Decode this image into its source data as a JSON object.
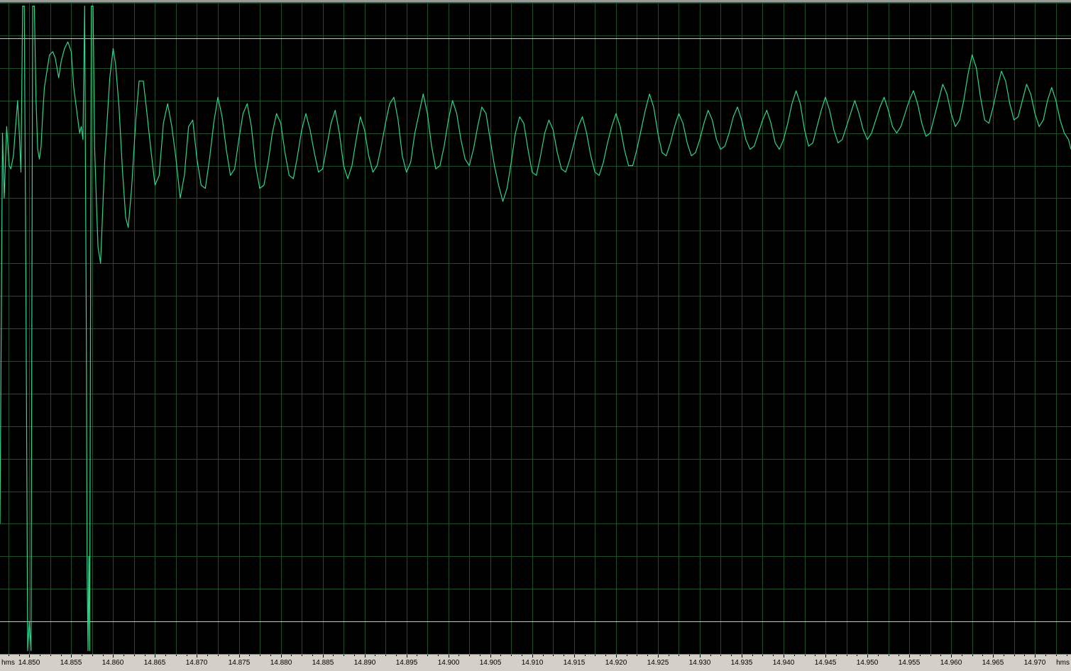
{
  "editor": {
    "time_unit_left": "hms",
    "time_unit_right": "hms"
  },
  "colors": {
    "background": "#000000",
    "grid": "#1d4d2a",
    "waveform": "#2fd58a",
    "center_line": "#a01818",
    "marker_line": "#c8c8c8",
    "ruler": "#d4d0c8"
  },
  "chart_data": {
    "type": "line",
    "xlabel": "hms",
    "ylabel": "",
    "xlim": [
      14.8465,
      14.9743
    ],
    "ylim": [
      -1,
      1
    ],
    "grid": true,
    "x_tick_labels": [
      "14.850",
      "14.855",
      "14.860",
      "14.865",
      "14.870",
      "14.875",
      "14.880",
      "14.885",
      "14.890",
      "14.895",
      "14.900",
      "14.905",
      "14.910",
      "14.915",
      "14.920",
      "14.925",
      "14.930",
      "14.935",
      "14.940",
      "14.945",
      "14.950",
      "14.955",
      "14.960",
      "14.965",
      "14.970"
    ],
    "reference_levels": [
      0.89,
      -0.9
    ],
    "series": [
      {
        "values": [
          [
            14.8465,
            -0.6
          ],
          [
            14.8468,
            0.6
          ],
          [
            14.847,
            0.4
          ],
          [
            14.8473,
            0.62
          ],
          [
            14.8476,
            0.5
          ],
          [
            14.8478,
            0.49
          ],
          [
            14.8481,
            0.53
          ],
          [
            14.8483,
            0.6
          ],
          [
            14.8486,
            0.7
          ],
          [
            14.8488,
            0.6
          ],
          [
            14.849,
            0.48
          ],
          [
            14.8492,
            0.99
          ],
          [
            14.8494,
            0.99
          ],
          [
            14.8496,
            0.1
          ],
          [
            14.8498,
            -0.99
          ],
          [
            14.85,
            -0.9
          ],
          [
            14.8502,
            -0.99
          ],
          [
            14.8504,
            0.99
          ],
          [
            14.8506,
            0.99
          ],
          [
            14.8508,
            0.7
          ],
          [
            14.851,
            0.55
          ],
          [
            14.8512,
            0.52
          ],
          [
            14.8514,
            0.56
          ],
          [
            14.8516,
            0.66
          ],
          [
            14.8518,
            0.74
          ],
          [
            14.8521,
            0.79
          ],
          [
            14.8524,
            0.84
          ],
          [
            14.8528,
            0.85
          ],
          [
            14.8531,
            0.83
          ],
          [
            14.8535,
            0.77
          ],
          [
            14.8538,
            0.82
          ],
          [
            14.8542,
            0.86
          ],
          [
            14.8546,
            0.88
          ],
          [
            14.855,
            0.85
          ],
          [
            14.8553,
            0.74
          ],
          [
            14.8557,
            0.66
          ],
          [
            14.856,
            0.6
          ],
          [
            14.8562,
            0.62
          ],
          [
            14.8564,
            0.58
          ],
          [
            14.8566,
            0.99
          ],
          [
            14.8568,
            0.0
          ],
          [
            14.8569,
            -0.75
          ],
          [
            14.857,
            -0.99
          ],
          [
            14.8571,
            -0.7
          ],
          [
            14.8572,
            -0.99
          ],
          [
            14.8574,
            0.99
          ],
          [
            14.8576,
            0.99
          ],
          [
            14.8578,
            0.55
          ],
          [
            14.858,
            0.39
          ],
          [
            14.8582,
            0.25
          ],
          [
            14.8585,
            0.2
          ],
          [
            14.859,
            0.52
          ],
          [
            14.8596,
            0.77
          ],
          [
            14.86,
            0.86
          ],
          [
            14.8603,
            0.81
          ],
          [
            14.8607,
            0.68
          ],
          [
            14.8611,
            0.49
          ],
          [
            14.8615,
            0.34
          ],
          [
            14.8618,
            0.31
          ],
          [
            14.8622,
            0.43
          ],
          [
            14.8627,
            0.64
          ],
          [
            14.8631,
            0.76
          ],
          [
            14.8636,
            0.76
          ],
          [
            14.864,
            0.67
          ],
          [
            14.8645,
            0.55
          ],
          [
            14.865,
            0.44
          ],
          [
            14.8655,
            0.47
          ],
          [
            14.866,
            0.63
          ],
          [
            14.8665,
            0.69
          ],
          [
            14.867,
            0.62
          ],
          [
            14.8675,
            0.52
          ],
          [
            14.868,
            0.4
          ],
          [
            14.8685,
            0.47
          ],
          [
            14.869,
            0.62
          ],
          [
            14.8695,
            0.64
          ],
          [
            14.87,
            0.52
          ],
          [
            14.8705,
            0.44
          ],
          [
            14.871,
            0.43
          ],
          [
            14.8715,
            0.52
          ],
          [
            14.872,
            0.63
          ],
          [
            14.8725,
            0.71
          ],
          [
            14.873,
            0.65
          ],
          [
            14.8735,
            0.55
          ],
          [
            14.874,
            0.47
          ],
          [
            14.8745,
            0.49
          ],
          [
            14.875,
            0.58
          ],
          [
            14.8755,
            0.66
          ],
          [
            14.876,
            0.69
          ],
          [
            14.8765,
            0.62
          ],
          [
            14.877,
            0.5
          ],
          [
            14.8775,
            0.43
          ],
          [
            14.878,
            0.44
          ],
          [
            14.8785,
            0.51
          ],
          [
            14.879,
            0.6
          ],
          [
            14.8795,
            0.66
          ],
          [
            14.88,
            0.63
          ],
          [
            14.8805,
            0.54
          ],
          [
            14.881,
            0.47
          ],
          [
            14.8815,
            0.46
          ],
          [
            14.882,
            0.53
          ],
          [
            14.8825,
            0.61
          ],
          [
            14.883,
            0.66
          ],
          [
            14.8835,
            0.61
          ],
          [
            14.884,
            0.54
          ],
          [
            14.8845,
            0.48
          ],
          [
            14.885,
            0.49
          ],
          [
            14.8855,
            0.56
          ],
          [
            14.886,
            0.63
          ],
          [
            14.8865,
            0.67
          ],
          [
            14.887,
            0.6
          ],
          [
            14.8875,
            0.5
          ],
          [
            14.888,
            0.46
          ],
          [
            14.8885,
            0.5
          ],
          [
            14.889,
            0.58
          ],
          [
            14.8895,
            0.65
          ],
          [
            14.89,
            0.61
          ],
          [
            14.8905,
            0.53
          ],
          [
            14.891,
            0.48
          ],
          [
            14.8915,
            0.5
          ],
          [
            14.892,
            0.56
          ],
          [
            14.8925,
            0.63
          ],
          [
            14.893,
            0.69
          ],
          [
            14.8935,
            0.71
          ],
          [
            14.894,
            0.64
          ],
          [
            14.8945,
            0.53
          ],
          [
            14.895,
            0.48
          ],
          [
            14.8955,
            0.51
          ],
          [
            14.896,
            0.6
          ],
          [
            14.8965,
            0.66
          ],
          [
            14.897,
            0.72
          ],
          [
            14.8975,
            0.66
          ],
          [
            14.898,
            0.56
          ],
          [
            14.8985,
            0.49
          ],
          [
            14.899,
            0.5
          ],
          [
            14.8995,
            0.56
          ],
          [
            14.9,
            0.64
          ],
          [
            14.9005,
            0.7
          ],
          [
            14.901,
            0.66
          ],
          [
            14.9015,
            0.58
          ],
          [
            14.902,
            0.52
          ],
          [
            14.9025,
            0.5
          ],
          [
            14.903,
            0.55
          ],
          [
            14.9035,
            0.62
          ],
          [
            14.904,
            0.68
          ],
          [
            14.9045,
            0.66
          ],
          [
            14.905,
            0.58
          ],
          [
            14.9055,
            0.5
          ],
          [
            14.906,
            0.44
          ],
          [
            14.9065,
            0.39
          ],
          [
            14.907,
            0.43
          ],
          [
            14.9075,
            0.51
          ],
          [
            14.908,
            0.6
          ],
          [
            14.9085,
            0.65
          ],
          [
            14.909,
            0.63
          ],
          [
            14.9095,
            0.55
          ],
          [
            14.91,
            0.48
          ],
          [
            14.9105,
            0.47
          ],
          [
            14.911,
            0.53
          ],
          [
            14.9115,
            0.6
          ],
          [
            14.912,
            0.64
          ],
          [
            14.9125,
            0.61
          ],
          [
            14.913,
            0.54
          ],
          [
            14.9135,
            0.49
          ],
          [
            14.914,
            0.48
          ],
          [
            14.9145,
            0.52
          ],
          [
            14.915,
            0.57
          ],
          [
            14.9155,
            0.62
          ],
          [
            14.916,
            0.65
          ],
          [
            14.9165,
            0.6
          ],
          [
            14.917,
            0.53
          ],
          [
            14.9175,
            0.48
          ],
          [
            14.918,
            0.47
          ],
          [
            14.9185,
            0.51
          ],
          [
            14.919,
            0.57
          ],
          [
            14.9195,
            0.62
          ],
          [
            14.92,
            0.66
          ],
          [
            14.9205,
            0.62
          ],
          [
            14.921,
            0.55
          ],
          [
            14.9215,
            0.5
          ],
          [
            14.922,
            0.5
          ],
          [
            14.9225,
            0.55
          ],
          [
            14.923,
            0.61
          ],
          [
            14.9235,
            0.67
          ],
          [
            14.924,
            0.72
          ],
          [
            14.9245,
            0.68
          ],
          [
            14.925,
            0.6
          ],
          [
            14.9255,
            0.54
          ],
          [
            14.926,
            0.53
          ],
          [
            14.9265,
            0.57
          ],
          [
            14.927,
            0.62
          ],
          [
            14.9275,
            0.66
          ],
          [
            14.928,
            0.63
          ],
          [
            14.9285,
            0.57
          ],
          [
            14.929,
            0.53
          ],
          [
            14.9295,
            0.54
          ],
          [
            14.93,
            0.58
          ],
          [
            14.9305,
            0.63
          ],
          [
            14.931,
            0.67
          ],
          [
            14.9315,
            0.64
          ],
          [
            14.932,
            0.58
          ],
          [
            14.9325,
            0.55
          ],
          [
            14.933,
            0.56
          ],
          [
            14.9335,
            0.6
          ],
          [
            14.934,
            0.65
          ],
          [
            14.9345,
            0.68
          ],
          [
            14.935,
            0.64
          ],
          [
            14.9355,
            0.58
          ],
          [
            14.936,
            0.55
          ],
          [
            14.9365,
            0.56
          ],
          [
            14.937,
            0.6
          ],
          [
            14.9375,
            0.64
          ],
          [
            14.938,
            0.67
          ],
          [
            14.9385,
            0.63
          ],
          [
            14.939,
            0.57
          ],
          [
            14.9395,
            0.55
          ],
          [
            14.94,
            0.58
          ],
          [
            14.9405,
            0.63
          ],
          [
            14.941,
            0.69
          ],
          [
            14.9415,
            0.73
          ],
          [
            14.942,
            0.69
          ],
          [
            14.9425,
            0.61
          ],
          [
            14.943,
            0.56
          ],
          [
            14.9435,
            0.57
          ],
          [
            14.944,
            0.62
          ],
          [
            14.9445,
            0.67
          ],
          [
            14.945,
            0.71
          ],
          [
            14.9455,
            0.67
          ],
          [
            14.946,
            0.61
          ],
          [
            14.9465,
            0.57
          ],
          [
            14.947,
            0.58
          ],
          [
            14.9475,
            0.62
          ],
          [
            14.948,
            0.66
          ],
          [
            14.9485,
            0.7
          ],
          [
            14.949,
            0.66
          ],
          [
            14.9495,
            0.61
          ],
          [
            14.95,
            0.58
          ],
          [
            14.9505,
            0.6
          ],
          [
            14.951,
            0.64
          ],
          [
            14.9515,
            0.68
          ],
          [
            14.952,
            0.71
          ],
          [
            14.9525,
            0.67
          ],
          [
            14.953,
            0.62
          ],
          [
            14.9535,
            0.6
          ],
          [
            14.954,
            0.62
          ],
          [
            14.9545,
            0.66
          ],
          [
            14.955,
            0.7
          ],
          [
            14.9555,
            0.73
          ],
          [
            14.956,
            0.69
          ],
          [
            14.9565,
            0.63
          ],
          [
            14.957,
            0.59
          ],
          [
            14.9575,
            0.6
          ],
          [
            14.958,
            0.65
          ],
          [
            14.9585,
            0.7
          ],
          [
            14.959,
            0.75
          ],
          [
            14.9595,
            0.72
          ],
          [
            14.96,
            0.66
          ],
          [
            14.9605,
            0.62
          ],
          [
            14.961,
            0.64
          ],
          [
            14.9615,
            0.7
          ],
          [
            14.962,
            0.78
          ],
          [
            14.9625,
            0.84
          ],
          [
            14.963,
            0.8
          ],
          [
            14.9635,
            0.71
          ],
          [
            14.964,
            0.64
          ],
          [
            14.9645,
            0.63
          ],
          [
            14.965,
            0.68
          ],
          [
            14.9655,
            0.74
          ],
          [
            14.966,
            0.79
          ],
          [
            14.9665,
            0.76
          ],
          [
            14.967,
            0.69
          ],
          [
            14.9675,
            0.64
          ],
          [
            14.968,
            0.65
          ],
          [
            14.9685,
            0.7
          ],
          [
            14.969,
            0.75
          ],
          [
            14.9695,
            0.72
          ],
          [
            14.97,
            0.66
          ],
          [
            14.9705,
            0.62
          ],
          [
            14.971,
            0.64
          ],
          [
            14.9715,
            0.7
          ],
          [
            14.972,
            0.74
          ],
          [
            14.9725,
            0.7
          ],
          [
            14.973,
            0.64
          ],
          [
            14.9735,
            0.6
          ],
          [
            14.974,
            0.58
          ],
          [
            14.9743,
            0.55
          ]
        ]
      }
    ]
  }
}
